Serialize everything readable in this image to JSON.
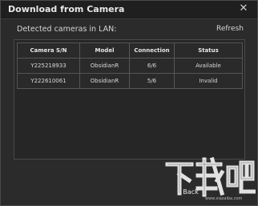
{
  "window": {
    "title": "Download from Camera",
    "close_glyph": "✕"
  },
  "detected_label": "Detected cameras in LAN:",
  "refresh_label": "Refresh",
  "table": {
    "headers": [
      "Camera S/N",
      "Model",
      "Connection",
      "Status"
    ],
    "rows": [
      [
        "Y225218933",
        "ObsidianR",
        "6/6",
        "Available"
      ],
      [
        "Y222610061",
        "ObsidianR",
        "5/6",
        "Invalid"
      ]
    ]
  },
  "back_label": "Back",
  "watermark": {
    "text": "下载吧",
    "sub_text": "www.xiazaiba.com"
  },
  "colors": {
    "dialog_bg": "#2b2b2b",
    "titlebar_bg": "#1f1f1f",
    "text": "#d4d4d4",
    "border": "#565656"
  },
  "icons": {
    "close": "close-icon"
  }
}
